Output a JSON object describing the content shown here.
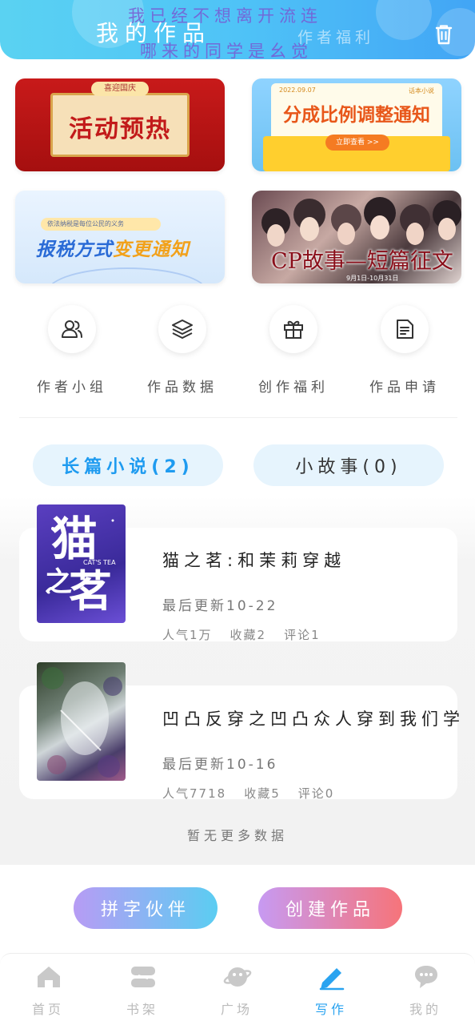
{
  "header": {
    "title": "我的作品",
    "welfare_link": "作者福利",
    "marquee_line1": "我已经不想离开流连",
    "marquee_line2": "哪来的同学是幺觉"
  },
  "banners": [
    {
      "tag": "喜迎国庆",
      "text": "活动预热"
    },
    {
      "date": "2022.09.07",
      "tag": "话本小说",
      "text": "分成比例调整通知",
      "button": "立即查看 >>"
    },
    {
      "subtitle": "依法纳税是每位公民的义务",
      "text_main": "报税方式",
      "text_accent": "变更通知"
    },
    {
      "text": "CP故事—短篇征文",
      "dates": "9月1日-10月31日"
    }
  ],
  "shortcuts": [
    {
      "label": "作者小组",
      "icon": "users-icon"
    },
    {
      "label": "作品数据",
      "icon": "layers-icon"
    },
    {
      "label": "创作福利",
      "icon": "gift-icon"
    },
    {
      "label": "作品申请",
      "icon": "document-icon"
    }
  ],
  "tabs": {
    "long_novel": "长篇小说(2)",
    "short_story": "小故事(0)"
  },
  "books": [
    {
      "title": "猫之茗:和茉莉穿越",
      "updated": "最后更新10-22",
      "popularity": "人气1万",
      "favorites": "收藏2",
      "comments": "评论1",
      "cover_text": "猫之茗",
      "cover_sub": "CAT'S TEA"
    },
    {
      "title": "凹凸反穿之凹凸众人穿到我们学",
      "updated": "最后更新10-16",
      "popularity": "人气7718",
      "favorites": "收藏5",
      "comments": "评论0"
    }
  ],
  "no_more": "暂无更多数据",
  "buttons": {
    "partner": "拼字伙伴",
    "create": "创建作品"
  },
  "nav": [
    {
      "label": "首页",
      "icon": "home-icon"
    },
    {
      "label": "书架",
      "icon": "bookshelf-icon"
    },
    {
      "label": "广场",
      "icon": "planet-icon"
    },
    {
      "label": "写作",
      "icon": "pen-icon",
      "active": true
    },
    {
      "label": "我的",
      "icon": "chat-bubble-icon"
    }
  ],
  "colors": {
    "accent": "#29a3f0",
    "header_gradient_start": "#5ad2f2",
    "header_gradient_end": "#42a5f5"
  }
}
